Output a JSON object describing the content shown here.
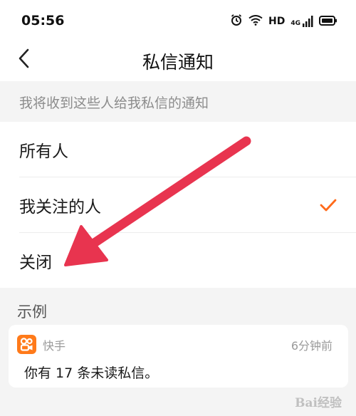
{
  "status_bar": {
    "time": "05:56",
    "hd_label": "HD",
    "network_label": "4G",
    "icons": [
      "alarm-icon",
      "wifi-icon",
      "signal-icon",
      "battery-icon"
    ]
  },
  "nav": {
    "title": "私信通知",
    "back_icon": "chevron-left-icon"
  },
  "section_header": "我将收到这些人给我私信的通知",
  "options": [
    {
      "label": "所有人",
      "selected": false
    },
    {
      "label": "我关注的人",
      "selected": true
    },
    {
      "label": "关闭",
      "selected": false
    }
  ],
  "example": {
    "label": "示例",
    "app_name": "快手",
    "time": "6分钟前",
    "message": "你有 17 条未读私信。"
  },
  "annotation": {
    "type": "arrow",
    "color": "#e8344f",
    "points_to": "关闭"
  },
  "watermark": "Bai经验",
  "colors": {
    "accent": "#ff6a1a",
    "app_icon": "#ff7a1a",
    "background": "#f4f4f4"
  }
}
